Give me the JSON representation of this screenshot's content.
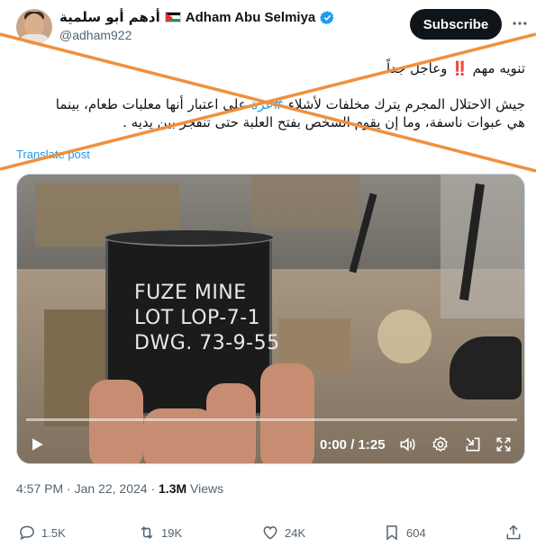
{
  "author": {
    "name_ar": "أدهم أبو سلمية",
    "name_en": "Adham Abu Selmiya",
    "handle": "@adham922"
  },
  "header": {
    "subscribe_label": "Subscribe",
    "more_icon": "ellipsis-icon"
  },
  "tweet": {
    "line1": "تنويه مهم ‼️ وعاجل جداً",
    "line2_before": "جيش الاحتلال المجرم يترك مخلفات لأشلاء ",
    "hashtag": "#غزة",
    "line2_after": " على اعتبار أنها معلبات طعام، بينما",
    "line3": "هي عبوات ناسفة، وما إن يقوم الشخص بفتح العلبة حتى تنفجر بين يديه .",
    "translate": "Translate post"
  },
  "video": {
    "label_lines": [
      "FUZE MINE",
      "LOT LOP-7-1",
      "DWG. 73-9-55"
    ],
    "time": "0:00 / 1:25",
    "progress": 0
  },
  "meta": {
    "time": "4:57 PM",
    "date": "Jan 22, 2024",
    "separator": "·",
    "views_count": "1.3M",
    "views_label": "Views"
  },
  "actions": {
    "replies": "1.5K",
    "reposts": "19K",
    "likes": "24K",
    "bookmarks": "604"
  },
  "colors": {
    "accent": "#1d9bf0",
    "cross": "#f0903c",
    "text": "#0f1419",
    "muted": "#536471"
  }
}
